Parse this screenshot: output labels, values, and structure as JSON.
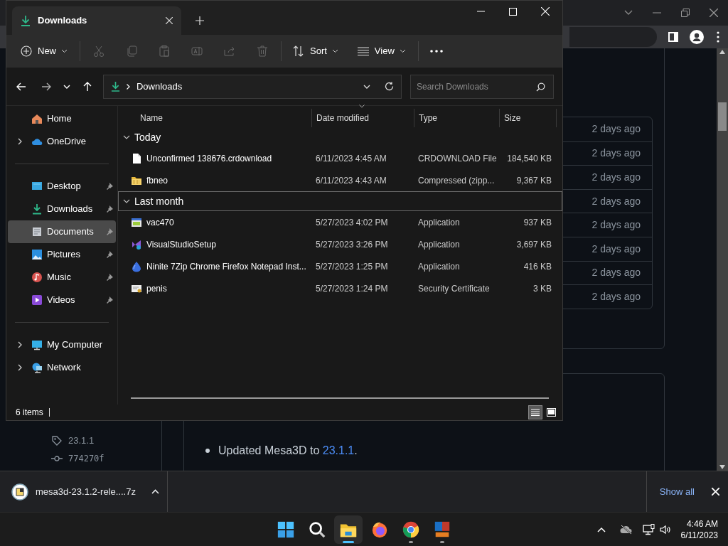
{
  "browser": {
    "release_list": {
      "rows": [
        {
          "time": "2 days ago"
        },
        {
          "time": "2 days ago"
        },
        {
          "time": "2 days ago"
        },
        {
          "time": "2 days ago"
        },
        {
          "time": "2 days ago"
        },
        {
          "time": "2 days ago"
        },
        {
          "time": "2 days ago"
        },
        {
          "time": "2 days ago"
        }
      ]
    },
    "sidebar": {
      "tag": "23.1.1",
      "commit": "774270f"
    },
    "notes": [
      {
        "text": "Updated Mesa3D to ",
        "link": "23.1.1",
        "after": "."
      }
    ]
  },
  "download_bar": {
    "file": "mesa3d-23.1.2-rele....7z",
    "show_all": "Show all"
  },
  "explorer": {
    "tab": {
      "title": "Downloads"
    },
    "toolbar": {
      "new": "New",
      "sort": "Sort",
      "view": "View"
    },
    "address": {
      "path": "Downloads"
    },
    "search": {
      "placeholder": "Search Downloads"
    },
    "nav": [
      [
        {
          "kind": "home",
          "label": "Home",
          "expandable": false,
          "pinned": false,
          "selected": false
        },
        {
          "kind": "cloud",
          "label": "OneDrive",
          "expandable": true,
          "pinned": false,
          "selected": false
        }
      ],
      [
        {
          "kind": "desktop",
          "label": "Desktop",
          "expandable": false,
          "pinned": true,
          "selected": false
        },
        {
          "kind": "download",
          "label": "Downloads",
          "expandable": false,
          "pinned": true,
          "selected": false
        },
        {
          "kind": "documents",
          "label": "Documents",
          "expandable": false,
          "pinned": true,
          "selected": true
        },
        {
          "kind": "pictures",
          "label": "Pictures",
          "expandable": false,
          "pinned": true,
          "selected": false
        },
        {
          "kind": "music",
          "label": "Music",
          "expandable": false,
          "pinned": true,
          "selected": false
        },
        {
          "kind": "videos",
          "label": "Videos",
          "expandable": false,
          "pinned": true,
          "selected": false
        }
      ],
      [
        {
          "kind": "computer",
          "label": "My Computer",
          "expandable": true,
          "pinned": false,
          "selected": false
        },
        {
          "kind": "network",
          "label": "Network",
          "expandable": true,
          "pinned": false,
          "selected": false
        }
      ]
    ],
    "columns": [
      {
        "label": "Name",
        "sorted": false
      },
      {
        "label": "Date modified",
        "sorted": true
      },
      {
        "label": "Type",
        "sorted": false
      },
      {
        "label": "Size",
        "sorted": false
      }
    ],
    "groups": [
      {
        "label": "Today",
        "focused": false,
        "files": [
          {
            "kind": "blank",
            "name": "Unconfirmed 138676.crdownload",
            "date": "6/11/2023 4:45 AM",
            "type": "CRDOWNLOAD File",
            "size": "184,540 KB"
          },
          {
            "kind": "zip",
            "name": "fbneo",
            "date": "6/11/2023 4:43 AM",
            "type": "Compressed (zipp...",
            "size": "9,367 KB"
          }
        ]
      },
      {
        "label": "Last month",
        "focused": true,
        "files": [
          {
            "kind": "app-window",
            "name": "vac470",
            "date": "5/27/2023 4:02 PM",
            "type": "Application",
            "size": "937 KB"
          },
          {
            "kind": "app-vs",
            "name": "VisualStudioSetup",
            "date": "5/27/2023 3:26 PM",
            "type": "Application",
            "size": "3,697 KB"
          },
          {
            "kind": "app-drop",
            "name": "Ninite 7Zip Chrome Firefox Notepad Inst...",
            "date": "5/27/2023 1:25 PM",
            "type": "Application",
            "size": "416 KB"
          },
          {
            "kind": "cert",
            "name": "penis",
            "date": "5/27/2023 1:24 PM",
            "type": "Security Certificate",
            "size": "3 KB"
          }
        ]
      }
    ],
    "status": "6 items",
    "views": [
      {
        "kind": "details",
        "selected": true
      },
      {
        "kind": "tiles",
        "selected": false
      }
    ]
  },
  "taskbar": {
    "apps": [
      {
        "kind": "start",
        "running": false,
        "selected": false
      },
      {
        "kind": "search",
        "running": false,
        "selected": false
      },
      {
        "kind": "folder",
        "running": true,
        "selected": true
      },
      {
        "kind": "firefox",
        "running": false,
        "selected": false
      },
      {
        "kind": "chrome",
        "running": true,
        "selected": false
      },
      {
        "kind": "neo",
        "running": true,
        "selected": false
      }
    ],
    "time": "4:46 AM",
    "date": "6/11/2023"
  }
}
